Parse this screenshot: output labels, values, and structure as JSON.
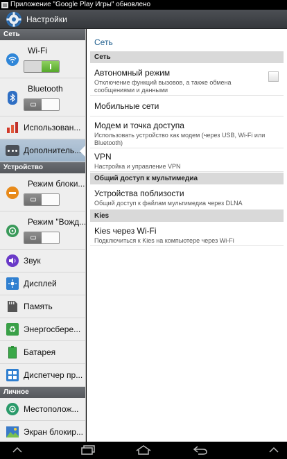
{
  "status_bar": {
    "notification": "Приложение \"Google Play Игры\" обновлено"
  },
  "action_bar": {
    "title": "Настройки",
    "icon": "gear-icon"
  },
  "left_pane": {
    "sections": [
      {
        "header": "Сеть"
      },
      {
        "header": "Устройство"
      },
      {
        "header": "Личное"
      }
    ],
    "items": [
      {
        "label": "Wi-Fi",
        "icon": "wifi-icon",
        "toggle": "on"
      },
      {
        "label": "Bluetooth",
        "icon": "bluetooth-icon",
        "toggle": "off"
      },
      {
        "label": "Использован...",
        "icon": "data-usage-icon"
      },
      {
        "label": "Дополнитель...",
        "icon": "more-icon",
        "selected": true
      },
      {
        "label": "Режим блоки...",
        "icon": "blocking-mode-icon",
        "toggle": "off"
      },
      {
        "label": "Режим \"Вожд...",
        "icon": "driving-mode-icon",
        "toggle": "off"
      },
      {
        "label": "Звук",
        "icon": "sound-icon"
      },
      {
        "label": "Дисплей",
        "icon": "display-icon"
      },
      {
        "label": "Память",
        "icon": "storage-icon"
      },
      {
        "label": "Энергосбере...",
        "icon": "power-saving-icon"
      },
      {
        "label": "Батарея",
        "icon": "battery-icon"
      },
      {
        "label": "Диспетчер пр...",
        "icon": "app-manager-icon"
      },
      {
        "label": "Местополож...",
        "icon": "location-icon"
      },
      {
        "label": "Экран блокир...",
        "icon": "lock-screen-icon"
      }
    ]
  },
  "right_pane": {
    "breadcrumb": "Сеть",
    "sections": [
      {
        "header": "Сеть"
      },
      {
        "header": "Общий доступ к мультимедиа"
      },
      {
        "header": "Kies"
      }
    ],
    "items": [
      {
        "title": "Автономный режим",
        "subtitle": "Отключение функций вызовов, а также обмена сообщениями и данными",
        "checked": false
      },
      {
        "title": "Мобильные сети",
        "subtitle": ""
      },
      {
        "title": "Модем и точка доступа",
        "subtitle": "Использовать устройство как модем (через USB, Wi-Fi или Bluetooth)"
      },
      {
        "title": "VPN",
        "subtitle": "Настройка и управление VPN"
      },
      {
        "title": "Устройства поблизости",
        "subtitle": "Общий доступ к файлам мультимедиа через DLNA"
      },
      {
        "title": "Kies через Wi-Fi",
        "subtitle": "Подключиться к Kies на компьютере через Wi-Fi"
      }
    ]
  },
  "nav_bar": {
    "buttons": [
      "collapse-icon",
      "recent-apps-icon",
      "home-icon",
      "back-icon",
      "menu-icon"
    ]
  },
  "colors": {
    "accent": "#1e5e8e",
    "toggle_on": "#6cbf3c",
    "selected": "#a8bdd1"
  }
}
